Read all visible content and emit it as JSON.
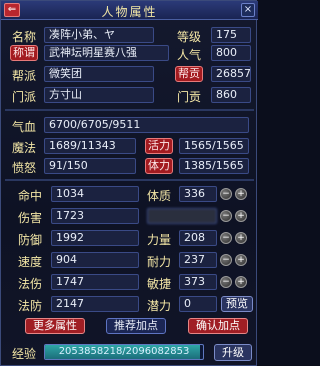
{
  "window": {
    "title": "人物属性",
    "back_glyph": "⇐",
    "close_glyph": "×"
  },
  "profile": {
    "name_label": "名称",
    "name_value": "凑阵小弟、ヤ",
    "level_label": "等级",
    "level_value": "175",
    "title_label": "称谓",
    "title_value": "武神坛明星赛八强",
    "popularity_label": "人气",
    "popularity_value": "800",
    "gang_label": "帮派",
    "gang_value": "微笑团",
    "gang_contrib_label": "帮贡",
    "gang_contrib_value": "26857",
    "sect_label": "门派",
    "sect_value": "方寸山",
    "sect_contrib_label": "门贡",
    "sect_contrib_value": "860"
  },
  "vitals": {
    "hp_label": "气血",
    "hp_value": "6700/6705/9511",
    "mp_label": "魔法",
    "mp_value": "1689/11343",
    "vigor_label": "活力",
    "vigor_value": "1565/1565",
    "rage_label": "愤怒",
    "rage_value": "91/150",
    "stamina_label": "体力",
    "stamina_value": "1385/1565"
  },
  "stats": {
    "hit_label": "命中",
    "hit_value": "1034",
    "damage_label": "伤害",
    "damage_value": "1723",
    "defense_label": "防御",
    "defense_value": "1992",
    "speed_label": "速度",
    "speed_value": "904",
    "spell_damage_label": "法伤",
    "spell_damage_value": "1747",
    "spell_defense_label": "法防",
    "spell_defense_value": "2147"
  },
  "attributes": {
    "constitution_label": "体质",
    "constitution_value": "336",
    "strength_label": "力量",
    "strength_value": "208",
    "endurance_label": "耐力",
    "endurance_value": "237",
    "agility_label": "敏捷",
    "agility_value": "373",
    "potential_label": "潜力",
    "potential_value": "0",
    "minus_glyph": "−",
    "plus_glyph": "+"
  },
  "buttons": {
    "preview": "预览",
    "more_attributes": "更多属性",
    "recommended_points": "推荐加点",
    "confirm_points": "确认加点",
    "upgrade": "升级"
  },
  "experience": {
    "label": "经验",
    "value": "2053858218/2096082853",
    "progress": 0.98
  },
  "colors": {
    "accent_gold": "#f3e6a6",
    "button_red": "#a01e24",
    "exp_fill": "#2ea7a7"
  }
}
